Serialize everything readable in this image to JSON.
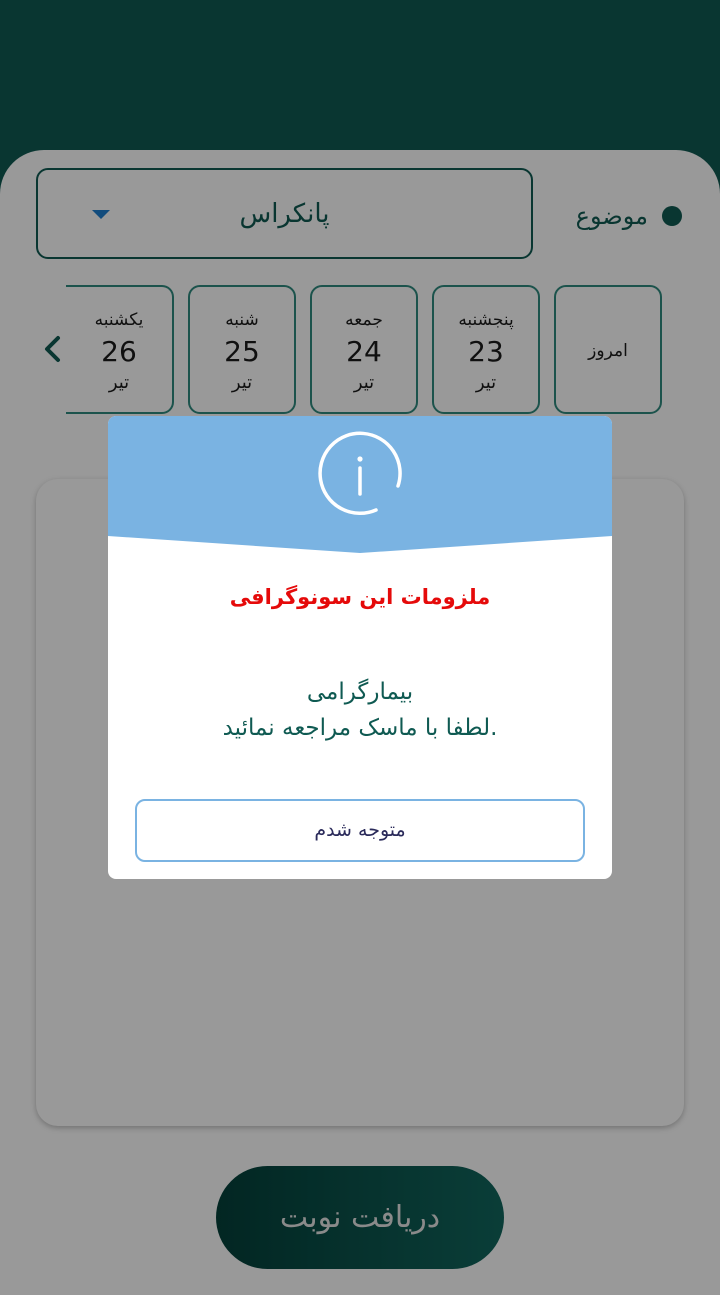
{
  "subject": {
    "label": "موضوع",
    "selected": "پانکراس"
  },
  "days": [
    {
      "type": "today",
      "label": "امروز"
    },
    {
      "name": "پنجشنبه",
      "number": "23",
      "month": "تیر"
    },
    {
      "name": "جمعه",
      "number": "24",
      "month": "تیر"
    },
    {
      "name": "شنبه",
      "number": "25",
      "month": "تیر"
    },
    {
      "name": "یکشنبه",
      "number": "26",
      "month": "تیر"
    }
  ],
  "submit": {
    "label": "دریافت نوبت"
  },
  "modal": {
    "title": "ملزومات این سونوگرافی",
    "body_line1": "بیمارگرامی",
    "body_line2": "لطفا با ماسک مراجعه نمائید.",
    "confirm_label": "متوجه شدم",
    "icon": "info-icon"
  },
  "colors": {
    "primary": "#0f5a52",
    "modal_header": "#7ab3e2",
    "title_red": "#e50a0a"
  }
}
